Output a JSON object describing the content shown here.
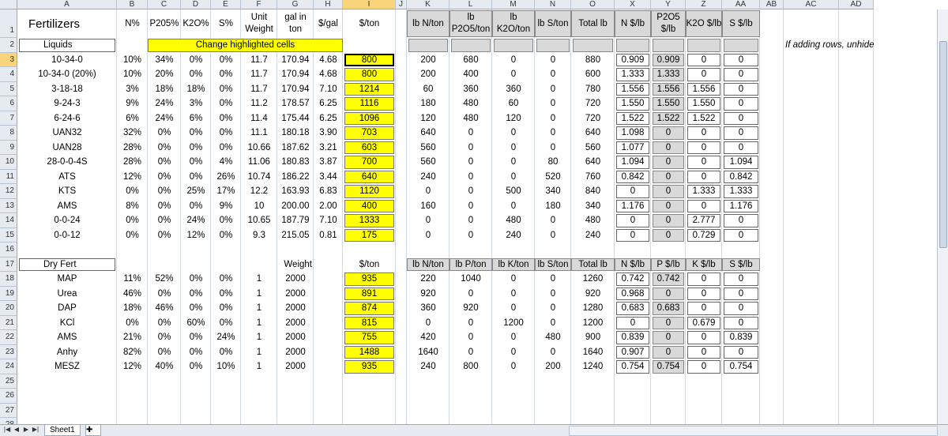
{
  "columns": [
    "A",
    "B",
    "C",
    "D",
    "E",
    "F",
    "G",
    "H",
    "I",
    "J",
    "K",
    "L",
    "M",
    "N",
    "O",
    "X",
    "Y",
    "Z",
    "AA",
    "AB",
    "AC",
    "AD"
  ],
  "rows": [
    "1",
    "2",
    "3",
    "4",
    "5",
    "6",
    "7",
    "8",
    "9",
    "10",
    "11",
    "12",
    "13",
    "14",
    "15",
    "16",
    "17",
    "18",
    "19",
    "20",
    "21",
    "22",
    "23",
    "24",
    "25",
    "26",
    "27",
    "28"
  ],
  "header": {
    "fertilizers": "Fertilizers",
    "n_pct": "N%",
    "p2o5_pct": "P205%",
    "k2o_pct": "K2O%",
    "s_pct": "S%",
    "unit_weight": "Unit Weight",
    "gal_in_ton": "gal in ton",
    "dollar_gal": "$/gal",
    "dollar_ton": "$/ton",
    "lb_n_ton": "lb N/ton",
    "lb_p2o5_ton": "lb P2O5/ton",
    "lb_k2o_ton": "lb K2O/ton",
    "lb_s_ton": "lb S/ton",
    "total_lb": "Total lb",
    "n_dollar_lb": "N $/lb",
    "p2o5_dollar_lb": "P2O5 $/lb",
    "k2o_dollar_lb": "K2O $/lb",
    "s_dollar_lb": "S $/lb"
  },
  "row2": {
    "liquids": "Liquids",
    "banner": "Change highlighted cells",
    "note": "If adding rows, unhide"
  },
  "liquids": [
    {
      "name": "10-34-0",
      "n": "10%",
      "p": "34%",
      "k": "0%",
      "s": "0%",
      "uw": "11.7",
      "gal": "170.94",
      "pg": "4.68",
      "pt": "800",
      "ln": "200",
      "lp": "680",
      "lk": "0",
      "ls": "0",
      "tot": "880",
      "nd": "0.909",
      "pd": "0.909",
      "kd": "0",
      "sd": "0"
    },
    {
      "name": "10-34-0 (20%)",
      "n": "10%",
      "p": "20%",
      "k": "0%",
      "s": "0%",
      "uw": "11.7",
      "gal": "170.94",
      "pg": "4.68",
      "pt": "800",
      "ln": "200",
      "lp": "400",
      "lk": "0",
      "ls": "0",
      "tot": "600",
      "nd": "1.333",
      "pd": "1.333",
      "kd": "0",
      "sd": "0"
    },
    {
      "name": "3-18-18",
      "n": "3%",
      "p": "18%",
      "k": "18%",
      "s": "0%",
      "uw": "11.7",
      "gal": "170.94",
      "pg": "7.10",
      "pt": "1214",
      "ln": "60",
      "lp": "360",
      "lk": "360",
      "ls": "0",
      "tot": "780",
      "nd": "1.556",
      "pd": "1.556",
      "kd": "1.556",
      "sd": "0"
    },
    {
      "name": "9-24-3",
      "n": "9%",
      "p": "24%",
      "k": "3%",
      "s": "0%",
      "uw": "11.2",
      "gal": "178.57",
      "pg": "6.25",
      "pt": "1116",
      "ln": "180",
      "lp": "480",
      "lk": "60",
      "ls": "0",
      "tot": "720",
      "nd": "1.550",
      "pd": "1.550",
      "kd": "1.550",
      "sd": "0"
    },
    {
      "name": "6-24-6",
      "n": "6%",
      "p": "24%",
      "k": "6%",
      "s": "0%",
      "uw": "11.4",
      "gal": "175.44",
      "pg": "6.25",
      "pt": "1096",
      "ln": "120",
      "lp": "480",
      "lk": "120",
      "ls": "0",
      "tot": "720",
      "nd": "1.522",
      "pd": "1.522",
      "kd": "1.522",
      "sd": "0"
    },
    {
      "name": "UAN32",
      "n": "32%",
      "p": "0%",
      "k": "0%",
      "s": "0%",
      "uw": "11.1",
      "gal": "180.18",
      "pg": "3.90",
      "pt": "703",
      "ln": "640",
      "lp": "0",
      "lk": "0",
      "ls": "0",
      "tot": "640",
      "nd": "1.098",
      "pd": "0",
      "kd": "0",
      "sd": "0"
    },
    {
      "name": "UAN28",
      "n": "28%",
      "p": "0%",
      "k": "0%",
      "s": "0%",
      "uw": "10.66",
      "gal": "187.62",
      "pg": "3.21",
      "pt": "603",
      "ln": "560",
      "lp": "0",
      "lk": "0",
      "ls": "0",
      "tot": "560",
      "nd": "1.077",
      "pd": "0",
      "kd": "0",
      "sd": "0"
    },
    {
      "name": "28-0-0-4S",
      "n": "28%",
      "p": "0%",
      "k": "0%",
      "s": "4%",
      "uw": "11.06",
      "gal": "180.83",
      "pg": "3.87",
      "pt": "700",
      "ln": "560",
      "lp": "0",
      "lk": "0",
      "ls": "80",
      "tot": "640",
      "nd": "1.094",
      "pd": "0",
      "kd": "0",
      "sd": "1.094"
    },
    {
      "name": "ATS",
      "n": "12%",
      "p": "0%",
      "k": "0%",
      "s": "26%",
      "uw": "10.74",
      "gal": "186.22",
      "pg": "3.44",
      "pt": "640",
      "ln": "240",
      "lp": "0",
      "lk": "0",
      "ls": "520",
      "tot": "760",
      "nd": "0.842",
      "pd": "0",
      "kd": "0",
      "sd": "0.842"
    },
    {
      "name": "KTS",
      "n": "0%",
      "p": "0%",
      "k": "25%",
      "s": "17%",
      "uw": "12.2",
      "gal": "163.93",
      "pg": "6.83",
      "pt": "1120",
      "ln": "0",
      "lp": "0",
      "lk": "500",
      "ls": "340",
      "tot": "840",
      "nd": "0",
      "pd": "0",
      "kd": "1.333",
      "sd": "1.333"
    },
    {
      "name": "AMS",
      "n": "8%",
      "p": "0%",
      "k": "0%",
      "s": "9%",
      "uw": "10",
      "gal": "200.00",
      "pg": "2.00",
      "pt": "400",
      "ln": "160",
      "lp": "0",
      "lk": "0",
      "ls": "180",
      "tot": "340",
      "nd": "1.176",
      "pd": "0",
      "kd": "0",
      "sd": "1.176"
    },
    {
      "name": "0-0-24",
      "n": "0%",
      "p": "0%",
      "k": "24%",
      "s": "0%",
      "uw": "10.65",
      "gal": "187.79",
      "pg": "7.10",
      "pt": "1333",
      "ln": "0",
      "lp": "0",
      "lk": "480",
      "ls": "0",
      "tot": "480",
      "nd": "0",
      "pd": "0",
      "kd": "2.777",
      "sd": "0"
    },
    {
      "name": "0-0-12",
      "n": "0%",
      "p": "0%",
      "k": "12%",
      "s": "0%",
      "uw": "9.3",
      "gal": "215.05",
      "pg": "0.81",
      "pt": "175",
      "ln": "0",
      "lp": "0",
      "lk": "240",
      "ls": "0",
      "tot": "240",
      "nd": "0",
      "pd": "0",
      "kd": "0.729",
      "sd": "0"
    }
  ],
  "dry_header": {
    "dry_fert": "Dry Fert",
    "weight": "Weight",
    "dollar_ton": "$/ton",
    "lb_n_ton": "lb N/ton",
    "lb_p_ton": "lb P/ton",
    "lb_k_ton": "lb K/ton",
    "lb_s_ton": "lb S/ton",
    "total_lb": "Total lb",
    "n_dollar_lb": "N $/lb",
    "p_dollar_lb": "P $/lb",
    "k_dollar_lb": "K $/lb",
    "s_dollar_lb": "S $/lb"
  },
  "dry": [
    {
      "name": "MAP",
      "n": "11%",
      "p": "52%",
      "k": "0%",
      "s": "0%",
      "uw": "1",
      "wt": "2000",
      "pt": "935",
      "ln": "220",
      "lp": "1040",
      "lk": "0",
      "ls": "0",
      "tot": "1260",
      "nd": "0.742",
      "pd": "0.742",
      "kd": "0",
      "sd": "0"
    },
    {
      "name": "Urea",
      "n": "46%",
      "p": "0%",
      "k": "0%",
      "s": "0%",
      "uw": "1",
      "wt": "2000",
      "pt": "891",
      "ln": "920",
      "lp": "0",
      "lk": "0",
      "ls": "0",
      "tot": "920",
      "nd": "0.968",
      "pd": "0",
      "kd": "0",
      "sd": "0"
    },
    {
      "name": "DAP",
      "n": "18%",
      "p": "46%",
      "k": "0%",
      "s": "0%",
      "uw": "1",
      "wt": "2000",
      "pt": "874",
      "ln": "360",
      "lp": "920",
      "lk": "0",
      "ls": "0",
      "tot": "1280",
      "nd": "0.683",
      "pd": "0.683",
      "kd": "0",
      "sd": "0"
    },
    {
      "name": "KCl",
      "n": "0%",
      "p": "0%",
      "k": "60%",
      "s": "0%",
      "uw": "1",
      "wt": "2000",
      "pt": "815",
      "ln": "0",
      "lp": "0",
      "lk": "1200",
      "ls": "0",
      "tot": "1200",
      "nd": "0",
      "pd": "0",
      "kd": "0.679",
      "sd": "0"
    },
    {
      "name": "AMS",
      "n": "21%",
      "p": "0%",
      "k": "0%",
      "s": "24%",
      "uw": "1",
      "wt": "2000",
      "pt": "755",
      "ln": "420",
      "lp": "0",
      "lk": "0",
      "ls": "480",
      "tot": "900",
      "nd": "0.839",
      "pd": "0",
      "kd": "0",
      "sd": "0.839"
    },
    {
      "name": "Anhy",
      "n": "82%",
      "p": "0%",
      "k": "0%",
      "s": "0%",
      "uw": "1",
      "wt": "2000",
      "pt": "1488",
      "ln": "1640",
      "lp": "0",
      "lk": "0",
      "ls": "0",
      "tot": "1640",
      "nd": "0.907",
      "pd": "0",
      "kd": "0",
      "sd": "0"
    },
    {
      "name": "MESZ",
      "n": "12%",
      "p": "40%",
      "k": "0%",
      "s": "10%",
      "uw": "1",
      "wt": "2000",
      "pt": "935",
      "ln": "240",
      "lp": "800",
      "lk": "0",
      "ls": "200",
      "tot": "1240",
      "nd": "0.754",
      "pd": "0.754",
      "kd": "0",
      "sd": "0.754"
    }
  ],
  "sheet_tab": "Sheet1",
  "colors": {
    "highlight": "#ffff00",
    "calc_gray": "#d9d9d9",
    "selection": "#f9d47b",
    "header_bg": "#e6ebf2"
  }
}
